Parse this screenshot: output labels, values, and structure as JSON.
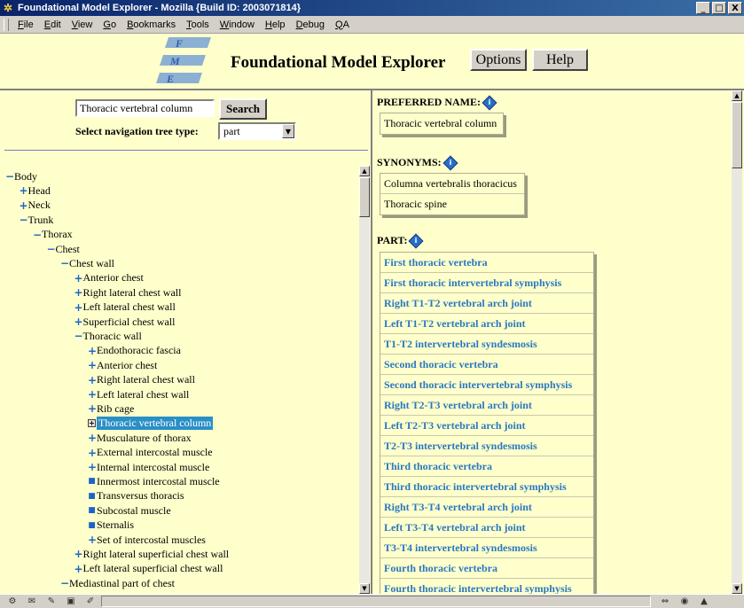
{
  "window": {
    "title": "Foundational Model Explorer - Mozilla {Build ID: 2003071814}",
    "controls": {
      "minimize": "_",
      "maximize": "□",
      "close": "X"
    }
  },
  "menubar": {
    "items": [
      {
        "label": "File",
        "accel": "F",
        "rest": "ile"
      },
      {
        "label": "Edit",
        "accel": "E",
        "rest": "dit"
      },
      {
        "label": "View",
        "accel": "V",
        "rest": "iew"
      },
      {
        "label": "Go",
        "accel": "G",
        "rest": "o"
      },
      {
        "label": "Bookmarks",
        "accel": "B",
        "rest": "ookmarks"
      },
      {
        "label": "Tools",
        "accel": "T",
        "rest": "ools"
      },
      {
        "label": "Window",
        "accel": "W",
        "rest": "indow"
      },
      {
        "label": "Help",
        "accel": "H",
        "rest": "elp"
      },
      {
        "label": "Debug",
        "accel": "D",
        "rest": "ebug"
      },
      {
        "label": "QA",
        "accel": "Q",
        "rest": "A"
      }
    ]
  },
  "banner": {
    "logo_letters": [
      "F",
      "M",
      "E"
    ],
    "title": "Foundational Model Explorer",
    "options_label": "Options",
    "help_label": "Help"
  },
  "search": {
    "value": "Thoracic vertebral column",
    "button_label": "Search",
    "nav_type_label": "Select navigation tree type:",
    "nav_type_value": "part"
  },
  "tree": {
    "nodes": [
      {
        "label": "Body",
        "level": 0,
        "toggle": "minus"
      },
      {
        "label": "Head",
        "level": 1,
        "toggle": "plus"
      },
      {
        "label": "Neck",
        "level": 1,
        "toggle": "plus"
      },
      {
        "label": "Trunk",
        "level": 1,
        "toggle": "minus"
      },
      {
        "label": "Thorax",
        "level": 2,
        "toggle": "minus"
      },
      {
        "label": "Chest",
        "level": 3,
        "toggle": "minus"
      },
      {
        "label": "Chest wall",
        "level": 4,
        "toggle": "minus"
      },
      {
        "label": "Anterior chest",
        "level": 5,
        "toggle": "plus"
      },
      {
        "label": "Right lateral chest wall",
        "level": 5,
        "toggle": "plus"
      },
      {
        "label": "Left lateral chest wall",
        "level": 5,
        "toggle": "plus"
      },
      {
        "label": "Superficial chest wall",
        "level": 5,
        "toggle": "plus"
      },
      {
        "label": "Thoracic wall",
        "level": 5,
        "toggle": "minus"
      },
      {
        "label": "Endothoracic fascia",
        "level": 6,
        "toggle": "plus"
      },
      {
        "label": "Anterior chest",
        "level": 6,
        "toggle": "plus"
      },
      {
        "label": "Right lateral chest wall",
        "level": 6,
        "toggle": "plus"
      },
      {
        "label": "Left lateral chest wall",
        "level": 6,
        "toggle": "plus"
      },
      {
        "label": "Rib cage",
        "level": 6,
        "toggle": "plus"
      },
      {
        "label": "Thoracic vertebral column",
        "level": 6,
        "toggle": "selected",
        "highlight": true
      },
      {
        "label": "Musculature of thorax",
        "level": 6,
        "toggle": "plus"
      },
      {
        "label": "External intercostal muscle",
        "level": 6,
        "toggle": "plus"
      },
      {
        "label": "Internal intercostal muscle",
        "level": 6,
        "toggle": "plus"
      },
      {
        "label": "Innermost intercostal muscle",
        "level": 6,
        "toggle": "dot"
      },
      {
        "label": "Transversus thoracis",
        "level": 6,
        "toggle": "dot"
      },
      {
        "label": "Subcostal muscle",
        "level": 6,
        "toggle": "dot"
      },
      {
        "label": "Sternalis",
        "level": 6,
        "toggle": "dot"
      },
      {
        "label": "Set of intercostal muscles",
        "level": 6,
        "toggle": "plus"
      },
      {
        "label": "Right lateral superficial chest wall",
        "level": 5,
        "toggle": "plus"
      },
      {
        "label": "Left lateral superficial chest wall",
        "level": 5,
        "toggle": "plus"
      },
      {
        "label": "Mediastinal part of chest",
        "level": 4,
        "toggle": "minus"
      }
    ]
  },
  "details": {
    "preferred_name_label": "PREFERRED NAME:",
    "preferred_name": "Thoracic vertebral column",
    "synonyms_label": "SYNONYMS:",
    "synonyms": [
      "Columna vertebralis thoracicus",
      "Thoracic spine"
    ],
    "part_label": "PART:",
    "parts": [
      "First thoracic vertebra",
      "First thoracic intervertebral symphysis",
      "Right T1-T2 vertebral arch joint",
      "Left T1-T2 vertebral arch joint",
      "T1-T2 intervertebral syndesmosis",
      "Second thoracic vertebra",
      "Second thoracic intervertebral symphysis",
      "Right T2-T3 vertebral arch joint",
      "Left T2-T3 vertebral arch joint",
      "T2-T3 intervertebral syndesmosis",
      "Third thoracic vertebra",
      "Third thoracic intervertebral symphysis",
      "Right T3-T4 vertebral arch joint",
      "Left T3-T4 vertebral arch joint",
      "T3-T4 intervertebral syndesmosis",
      "Fourth thoracic vertebra",
      "Fourth thoracic intervertebral symphysis"
    ]
  },
  "colors": {
    "background": "#ffffcc",
    "link": "#2a78c0",
    "highlight": "#2a8fc6",
    "toggle": "#1e64c8"
  }
}
